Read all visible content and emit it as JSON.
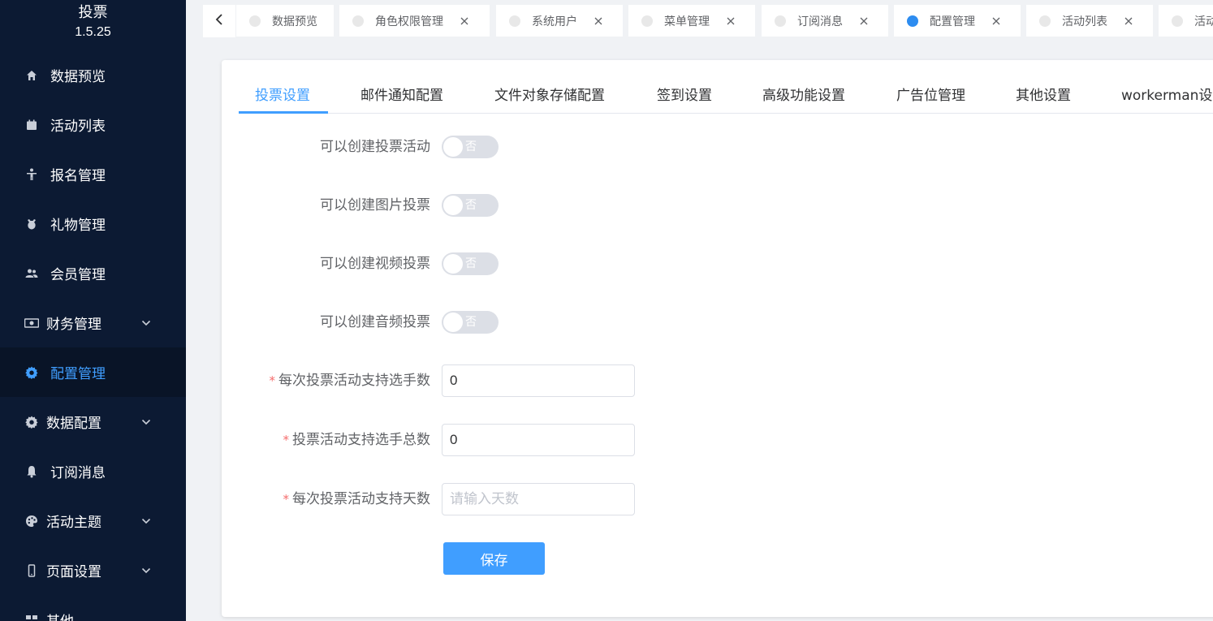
{
  "brand": {
    "title": "投票",
    "version": "1.5.25"
  },
  "sidebar": {
    "items": [
      {
        "label": "数据预览",
        "icon": "home-icon"
      },
      {
        "label": "活动列表",
        "icon": "calendar-icon"
      },
      {
        "label": "报名管理",
        "icon": "person-icon"
      },
      {
        "label": "礼物管理",
        "icon": "gift-icon"
      },
      {
        "label": "会员管理",
        "icon": "members-icon"
      },
      {
        "label": "财务管理",
        "icon": "money-icon",
        "has_children": true
      },
      {
        "label": "配置管理",
        "icon": "gear-icon",
        "active": true
      },
      {
        "label": "数据配置",
        "icon": "gear-icon",
        "has_children": true
      },
      {
        "label": "订阅消息",
        "icon": "bell-icon"
      },
      {
        "label": "活动主题",
        "icon": "palette-icon",
        "has_children": true
      },
      {
        "label": "页面设置",
        "icon": "mobile-icon",
        "has_children": true
      },
      {
        "label": "其他",
        "icon": "grid-icon"
      }
    ]
  },
  "tabs": [
    {
      "label": "数据预览",
      "closable": false
    },
    {
      "label": "角色权限管理",
      "closable": true
    },
    {
      "label": "系统用户",
      "closable": true
    },
    {
      "label": "菜单管理",
      "closable": true
    },
    {
      "label": "订阅消息",
      "closable": true
    },
    {
      "label": "配置管理",
      "closable": true,
      "active": true
    },
    {
      "label": "活动列表",
      "closable": true
    },
    {
      "label": "活动",
      "closable": false
    }
  ],
  "settings_tabs": [
    {
      "label": "投票设置",
      "active": true
    },
    {
      "label": "邮件通知配置"
    },
    {
      "label": "文件对象存储配置"
    },
    {
      "label": "签到设置"
    },
    {
      "label": "高级功能设置"
    },
    {
      "label": "广告位管理"
    },
    {
      "label": "其他设置"
    },
    {
      "label": "workerman设置"
    }
  ],
  "form": {
    "switches": [
      {
        "label": "可以创建投票活动",
        "value": "否"
      },
      {
        "label": "可以创建图片投票",
        "value": "否"
      },
      {
        "label": "可以创建视频投票",
        "value": "否"
      },
      {
        "label": "可以创建音频投票",
        "value": "否"
      }
    ],
    "inputs": [
      {
        "label": "每次投票活动支持选手数",
        "value": "0",
        "placeholder": "",
        "required": true
      },
      {
        "label": "投票活动支持选手总数",
        "value": "0",
        "placeholder": "",
        "required": true
      },
      {
        "label": "每次投票活动支持天数",
        "value": "",
        "placeholder": "请输入天数",
        "required": true
      }
    ],
    "save_label": "保存"
  },
  "colors": {
    "sidebar_bg": "#0c1a33",
    "accent": "#409eff",
    "required": "#f56c6c"
  }
}
